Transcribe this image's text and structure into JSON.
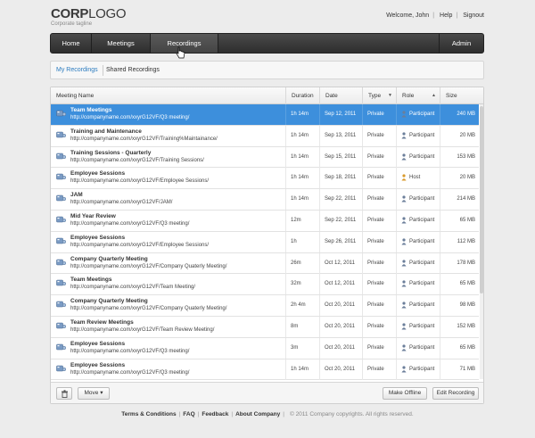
{
  "header": {
    "logo_bold": "CORP",
    "logo_rest": "LOGO",
    "tagline": "Corporate tagline",
    "welcome": "Welcome, John",
    "help": "Help",
    "signout": "Signout"
  },
  "nav": {
    "home": "Home",
    "meetings": "Meetings",
    "recordings": "Recordings",
    "admin": "Admin"
  },
  "subtabs": {
    "my": "My Recordings",
    "shared": "Shared Recordings"
  },
  "table": {
    "columns": [
      "Meeting Name",
      "Duration",
      "Date",
      "Type",
      "Role",
      "Size"
    ],
    "rows": [
      {
        "name": "Team Meetings",
        "url": "http://companyname.com/xxyrG12VF/Q3 meeting/",
        "duration": "1h 14m",
        "date": "Sep 12, 2011",
        "type": "Private",
        "role": "Participant",
        "size": "240 MB"
      },
      {
        "name": "Training and Maintenance",
        "url": "http://companyname.com/xxyrG12VF/Training%Maintainance/",
        "duration": "1h 14m",
        "date": "Sep 13, 2011",
        "type": "Private",
        "role": "Participant",
        "size": "20 MB"
      },
      {
        "name": "Training Sessions - Quarterly",
        "url": "http://companyname.com/xxyrG12VF/Training Sessions/",
        "duration": "1h 14m",
        "date": "Sep 15, 2011",
        "type": "Private",
        "role": "Participant",
        "size": "153 MB"
      },
      {
        "name": "Employee Sessions",
        "url": "http://companyname.com/xxyrG12VF/Employee Sessions/",
        "duration": "1h 14m",
        "date": "Sep 18, 2011",
        "type": "Private",
        "role": "Host",
        "size": "20 MB"
      },
      {
        "name": "JAM",
        "url": "http://companyname.com/xxyrG12VF/JAM/",
        "duration": "1h 14m",
        "date": "Sep 22, 2011",
        "type": "Private",
        "role": "Participant",
        "size": "214 MB"
      },
      {
        "name": "Mid Year Review",
        "url": "http://companyname.com/xxyrG12VF/Q3 meeting/",
        "duration": "12m",
        "date": "Sep 22, 2011",
        "type": "Private",
        "role": "Participant",
        "size": "65 MB"
      },
      {
        "name": "Employee Sessions",
        "url": "http://companyname.com/xxyrG12VF/Employee Sessions/",
        "duration": "1h",
        "date": "Sep 26, 2011",
        "type": "Private",
        "role": "Participant",
        "size": "112 MB"
      },
      {
        "name": "Company Quarterly Meeting",
        "url": "http://companyname.com/xxyrG12VF/Company Quaterly Meeting/",
        "duration": "26m",
        "date": "Oct 12, 2011",
        "type": "Private",
        "role": "Participant",
        "size": "178 MB"
      },
      {
        "name": "Team Meetings",
        "url": "http://companyname.com/xxyrG12VF/Team Meeting/",
        "duration": "32m",
        "date": "Oct 12, 2011",
        "type": "Private",
        "role": "Participant",
        "size": "65 MB"
      },
      {
        "name": "Company Quarterly Meeting",
        "url": "http://companyname.com/xxyrG12VF/Company Quaterly Meeting/",
        "duration": "2h 4m",
        "date": "Oct 20, 2011",
        "type": "Private",
        "role": "Participant",
        "size": "98 MB"
      },
      {
        "name": "Team Review Meetings",
        "url": "http://companyname.com/xxyrG12VF/Team Review Meeting/",
        "duration": "8m",
        "date": "Oct 20, 2011",
        "type": "Private",
        "role": "Participant",
        "size": "152 MB"
      },
      {
        "name": "Employee Sessions",
        "url": "http://companyname.com/xxyrG12VF/Q3 meeting/",
        "duration": "3m",
        "date": "Oct 20, 2011",
        "type": "Private",
        "role": "Participant",
        "size": "65 MB"
      },
      {
        "name": "Employee Sessions",
        "url": "http://companyname.com/xxyrG12VF/Q3 meeting/",
        "duration": "1h 14m",
        "date": "Oct 20, 2011",
        "type": "Private",
        "role": "Participant",
        "size": "71 MB"
      }
    ]
  },
  "actions": {
    "move": "Move",
    "make_offline": "Make Offline",
    "edit_recording": "Edit Recording"
  },
  "footer": {
    "terms": "Terms & Conditions",
    "faq": "FAQ",
    "feedback": "Feedback",
    "about": "About Company",
    "copyright": "© 2011 Company copyrights. All rights reserved."
  },
  "colors": {
    "selected_row": "#3d8fdc",
    "active_subtab": "#2b7bbf",
    "navbar": "#3a3a3a"
  },
  "icons": {
    "row_icon": "recording-icon",
    "role_icon": "person-icon",
    "host_icon": "host-icon",
    "trash": "trash-icon"
  }
}
